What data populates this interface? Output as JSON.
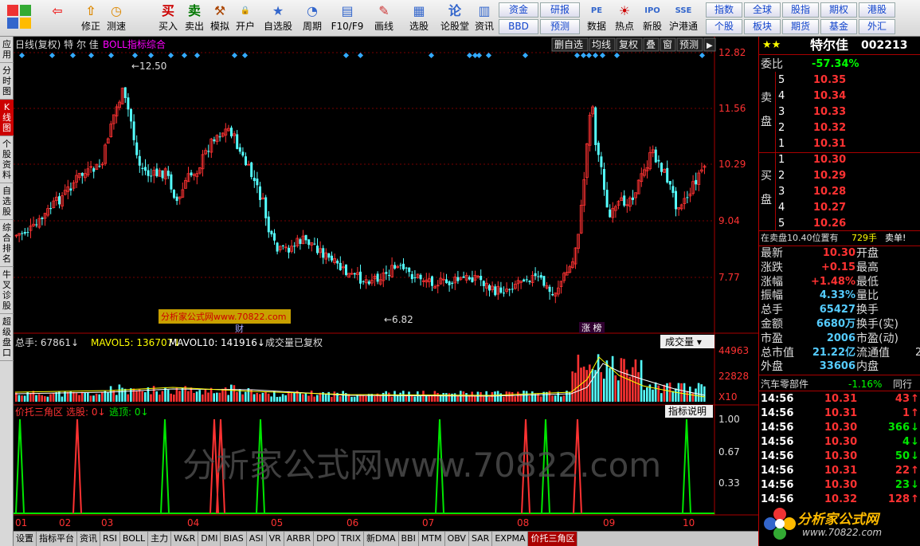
{
  "toolbar": {
    "buttons": [
      {
        "icon": "⇦",
        "label": ""
      },
      {
        "icon": "⇧",
        "label": "修正"
      },
      {
        "icon": "◷",
        "label": "测速"
      },
      {
        "icon": "买",
        "label": "买入"
      },
      {
        "icon": "卖",
        "label": "卖出"
      },
      {
        "icon": "⚒",
        "label": "模拟"
      },
      {
        "icon": "🔒",
        "label": "开户"
      },
      {
        "icon": "★",
        "label": "自选股"
      },
      {
        "icon": "◔",
        "label": "周期"
      },
      {
        "icon": "▤",
        "label": "F10/F9"
      },
      {
        "icon": "✎",
        "label": "画线"
      },
      {
        "icon": "▦",
        "label": "选股"
      },
      {
        "icon": "论",
        "label": "论股堂"
      },
      {
        "icon": "▥",
        "label": "资讯"
      },
      {
        "icon": "PE",
        "label": "数据"
      },
      {
        "icon": "☀",
        "label": "热点"
      },
      {
        "icon": "IPO",
        "label": "新股"
      },
      {
        "icon": "SSE",
        "label": "沪港通"
      }
    ],
    "grid1": [
      "资金",
      "研报",
      "BBD",
      "预测"
    ],
    "grid2": [
      "指数",
      "全球",
      "股指",
      "期权",
      "港股",
      "个股",
      "板块",
      "期货",
      "基金",
      "外汇"
    ]
  },
  "leftbar": [
    "应用",
    "分时图",
    "K线图",
    "个股资料",
    "自选股",
    "综合排名",
    "牛叉诊股",
    "超级盘口"
  ],
  "chart": {
    "header": "日线(复权) 特 尔 佳",
    "indicator": "BOLL指标综合",
    "buttons": [
      "删自选",
      "均线",
      "复权",
      "叠",
      "窗",
      "预测"
    ],
    "price_axis": [
      "12.82",
      "11.56",
      "10.29",
      "9.04",
      "7.77"
    ],
    "high_label": "12.50",
    "low_label": "6.82",
    "watermark_box": "分析家公式网www.70822.com",
    "cai_label": "财",
    "zhangbang_label": "涨 榜",
    "vol_header": {
      "total": "总手: 67861",
      "ma5": "MAVOL5: 136707",
      "ma10": "MAVOL10: 141916",
      "note": "成交量已复权",
      "select": "成交量"
    },
    "vol_axis": [
      "44963",
      "22828",
      "X10"
    ],
    "ind_header": {
      "name": "价托三角区",
      "pick": "选股: 0",
      "top": "逃顶: 0",
      "btn": "指标说明"
    },
    "ind_axis": [
      "1.00",
      "0.67",
      "0.33"
    ],
    "watermark_big": "分析家公式网www.70822.com",
    "months": [
      "01",
      "02",
      "03",
      "04",
      "05",
      "06",
      "07",
      "08",
      "09",
      "10"
    ]
  },
  "quote": {
    "name": "特尔佳",
    "code": "002213",
    "webi_label": "委比",
    "webi_value": "-57.34%",
    "sell_label": "卖盘",
    "buy_label": "买盘",
    "sell": [
      [
        "5",
        "10.35"
      ],
      [
        "4",
        "10.34"
      ],
      [
        "3",
        "10.33"
      ],
      [
        "2",
        "10.32"
      ],
      [
        "1",
        "10.31"
      ]
    ],
    "buy": [
      [
        "1",
        "10.30"
      ],
      [
        "2",
        "10.29"
      ],
      [
        "3",
        "10.28"
      ],
      [
        "4",
        "10.27"
      ],
      [
        "5",
        "10.26"
      ]
    ],
    "notice": "在卖盘10.40位置有",
    "notice_vol": "729手",
    "notice_tag": "卖单!",
    "stats": [
      [
        "最新",
        "10.30",
        "开盘",
        ""
      ],
      [
        "涨跌",
        "+0.15",
        "最高",
        ""
      ],
      [
        "涨幅",
        "+1.48%",
        "最低",
        ""
      ],
      [
        "振幅",
        "4.33%",
        "量比",
        ""
      ],
      [
        "总手",
        "65427",
        "换手",
        ""
      ],
      [
        "金额",
        "6680万",
        "换手(实)",
        ""
      ],
      [
        "市盈",
        "2006",
        "市盈(动)",
        ""
      ],
      [
        "总市值",
        "21.22亿",
        "流通值",
        "2"
      ],
      [
        "外盘",
        "33606",
        "内盘",
        ""
      ]
    ],
    "industry": "汽车零部件",
    "industry_pct": "-1.16%",
    "industry_tab": "同行",
    "ticks": [
      [
        "14:56",
        "10.31",
        "43",
        "up"
      ],
      [
        "14:56",
        "10.31",
        "1",
        "up"
      ],
      [
        "14:56",
        "10.30",
        "366",
        "down"
      ],
      [
        "14:56",
        "10.30",
        "4",
        "down"
      ],
      [
        "14:56",
        "10.30",
        "50",
        "down"
      ],
      [
        "14:56",
        "10.31",
        "22",
        "up"
      ],
      [
        "14:56",
        "10.30",
        "23",
        "down"
      ],
      [
        "14:56",
        "10.32",
        "128",
        "up"
      ]
    ],
    "logo_text": "分析家公式网",
    "logo_url": "www.70822.com"
  },
  "bottomtabs": [
    "设置",
    "指标平台",
    "资讯",
    "RSI",
    "BOLL",
    "主力",
    "W&R",
    "DMI",
    "BIAS",
    "ASI",
    "VR",
    "ARBR",
    "DPO",
    "TRIX",
    "新DMA",
    "BBI",
    "MTM",
    "OBV",
    "SAR",
    "EXPMA",
    "价托三角区"
  ],
  "colors": {
    "up": "#ff3232",
    "down": "#54ffff",
    "yellow": "#ffff00",
    "magenta": "#ff00ff",
    "green": "#00e600"
  }
}
